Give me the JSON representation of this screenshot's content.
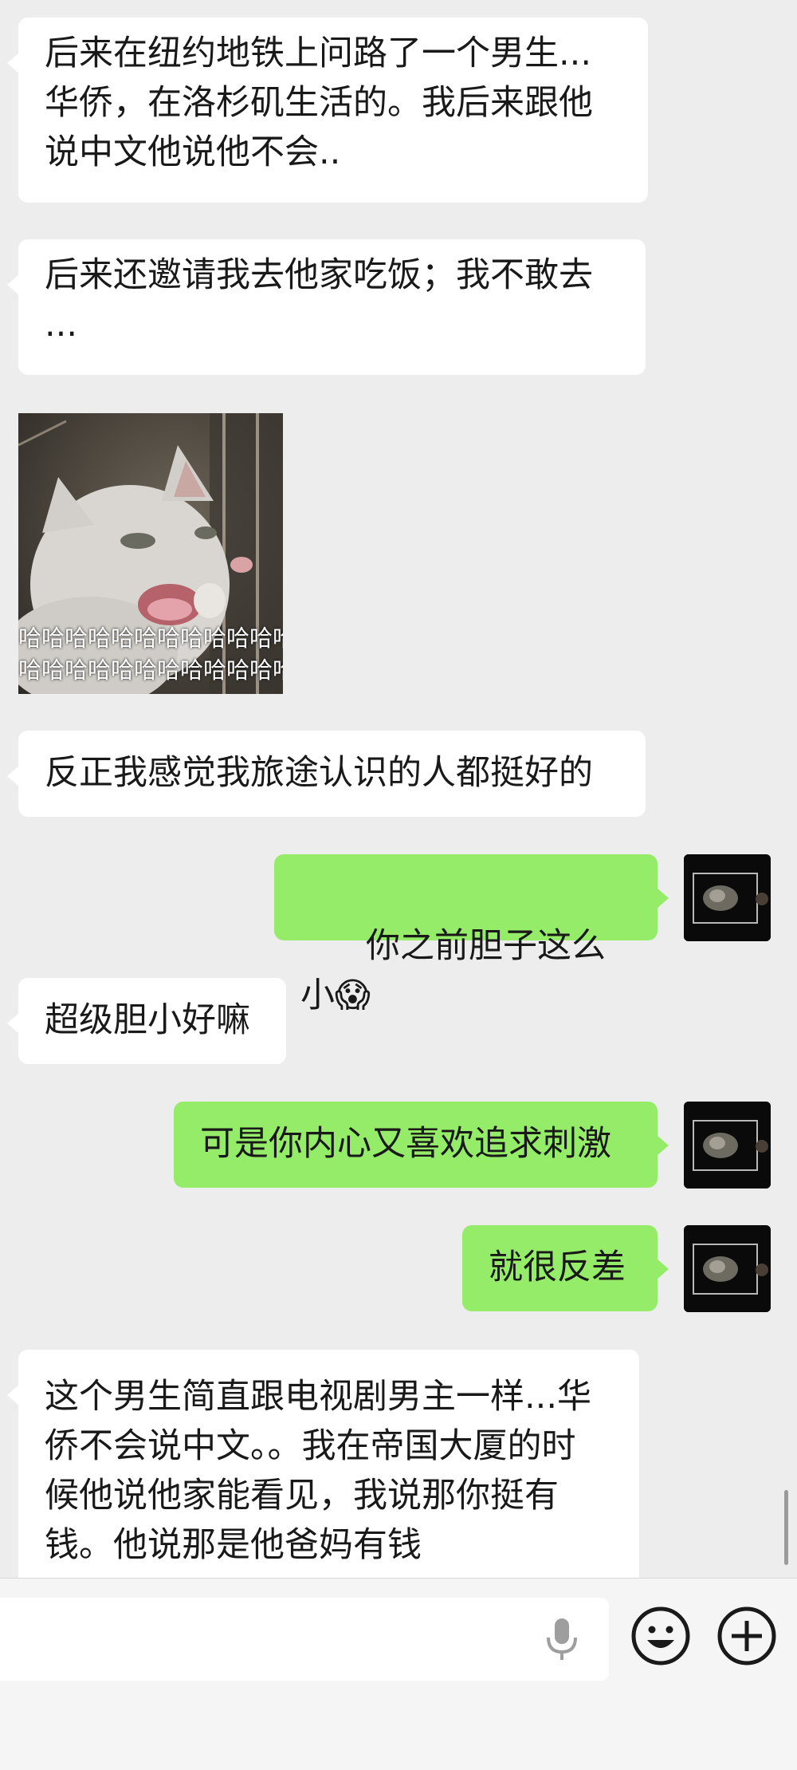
{
  "messages": [
    {
      "text": "后来在纽约地铁上问路了一个男生...\n华侨，在洛杉矶生活的。我后来跟他\n说中文他说他不会.."
    },
    {
      "text": "后来还邀请我去他家吃饭；我不敢去\n..."
    },
    {
      "sticker_caption_1": "哈哈哈哈哈哈哈哈哈哈哈哈",
      "sticker_caption_2": "哈哈哈哈哈哈哈哈哈哈哈哈"
    },
    {
      "text": "反正我感觉我旅途认识的人都挺好的"
    },
    {
      "text": "你之前胆子这么小",
      "emoji": "😱"
    },
    {
      "text": "超级胆小好嘛"
    },
    {
      "text": "可是你内心又喜欢追求刺激"
    },
    {
      "text": "就很反差"
    },
    {
      "text": "这个男生简直跟电视剧男主一样...华\n侨不会说中文。。我在帝国大厦的时\n候他说他家能看见，我说那你挺有\n钱。他说那是他爸妈有钱"
    }
  ],
  "icons": {
    "voice": "microphone-icon",
    "emoji": "smiley-icon",
    "more": "plus-circle-icon"
  },
  "colors": {
    "background": "#ededed",
    "incoming_bubble": "#ffffff",
    "outgoing_bubble": "#95ec69"
  }
}
